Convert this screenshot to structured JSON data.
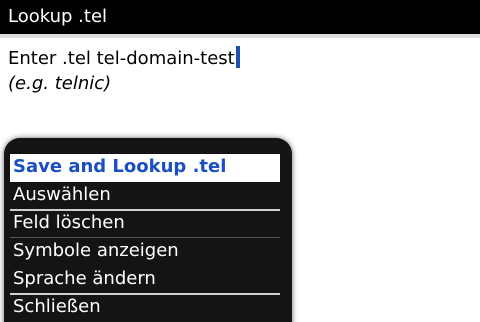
{
  "window": {
    "title": "Lookup .tel"
  },
  "field": {
    "label": "Enter .tel",
    "value": "tel-domain-test",
    "hint": "(e.g. telnic)"
  },
  "menu": {
    "items": [
      {
        "label": "Save and Lookup .tel",
        "selected": true
      },
      {
        "label": "Auswählen"
      },
      {
        "label": "Feld löschen"
      },
      {
        "label": "Symbole anzeigen"
      },
      {
        "label": "Sprache ändern"
      },
      {
        "label": "Schließen"
      }
    ]
  },
  "colors": {
    "selection_text": "#1a4fc2",
    "cursor": "#1e4fb3",
    "menu_background": "#141414"
  }
}
